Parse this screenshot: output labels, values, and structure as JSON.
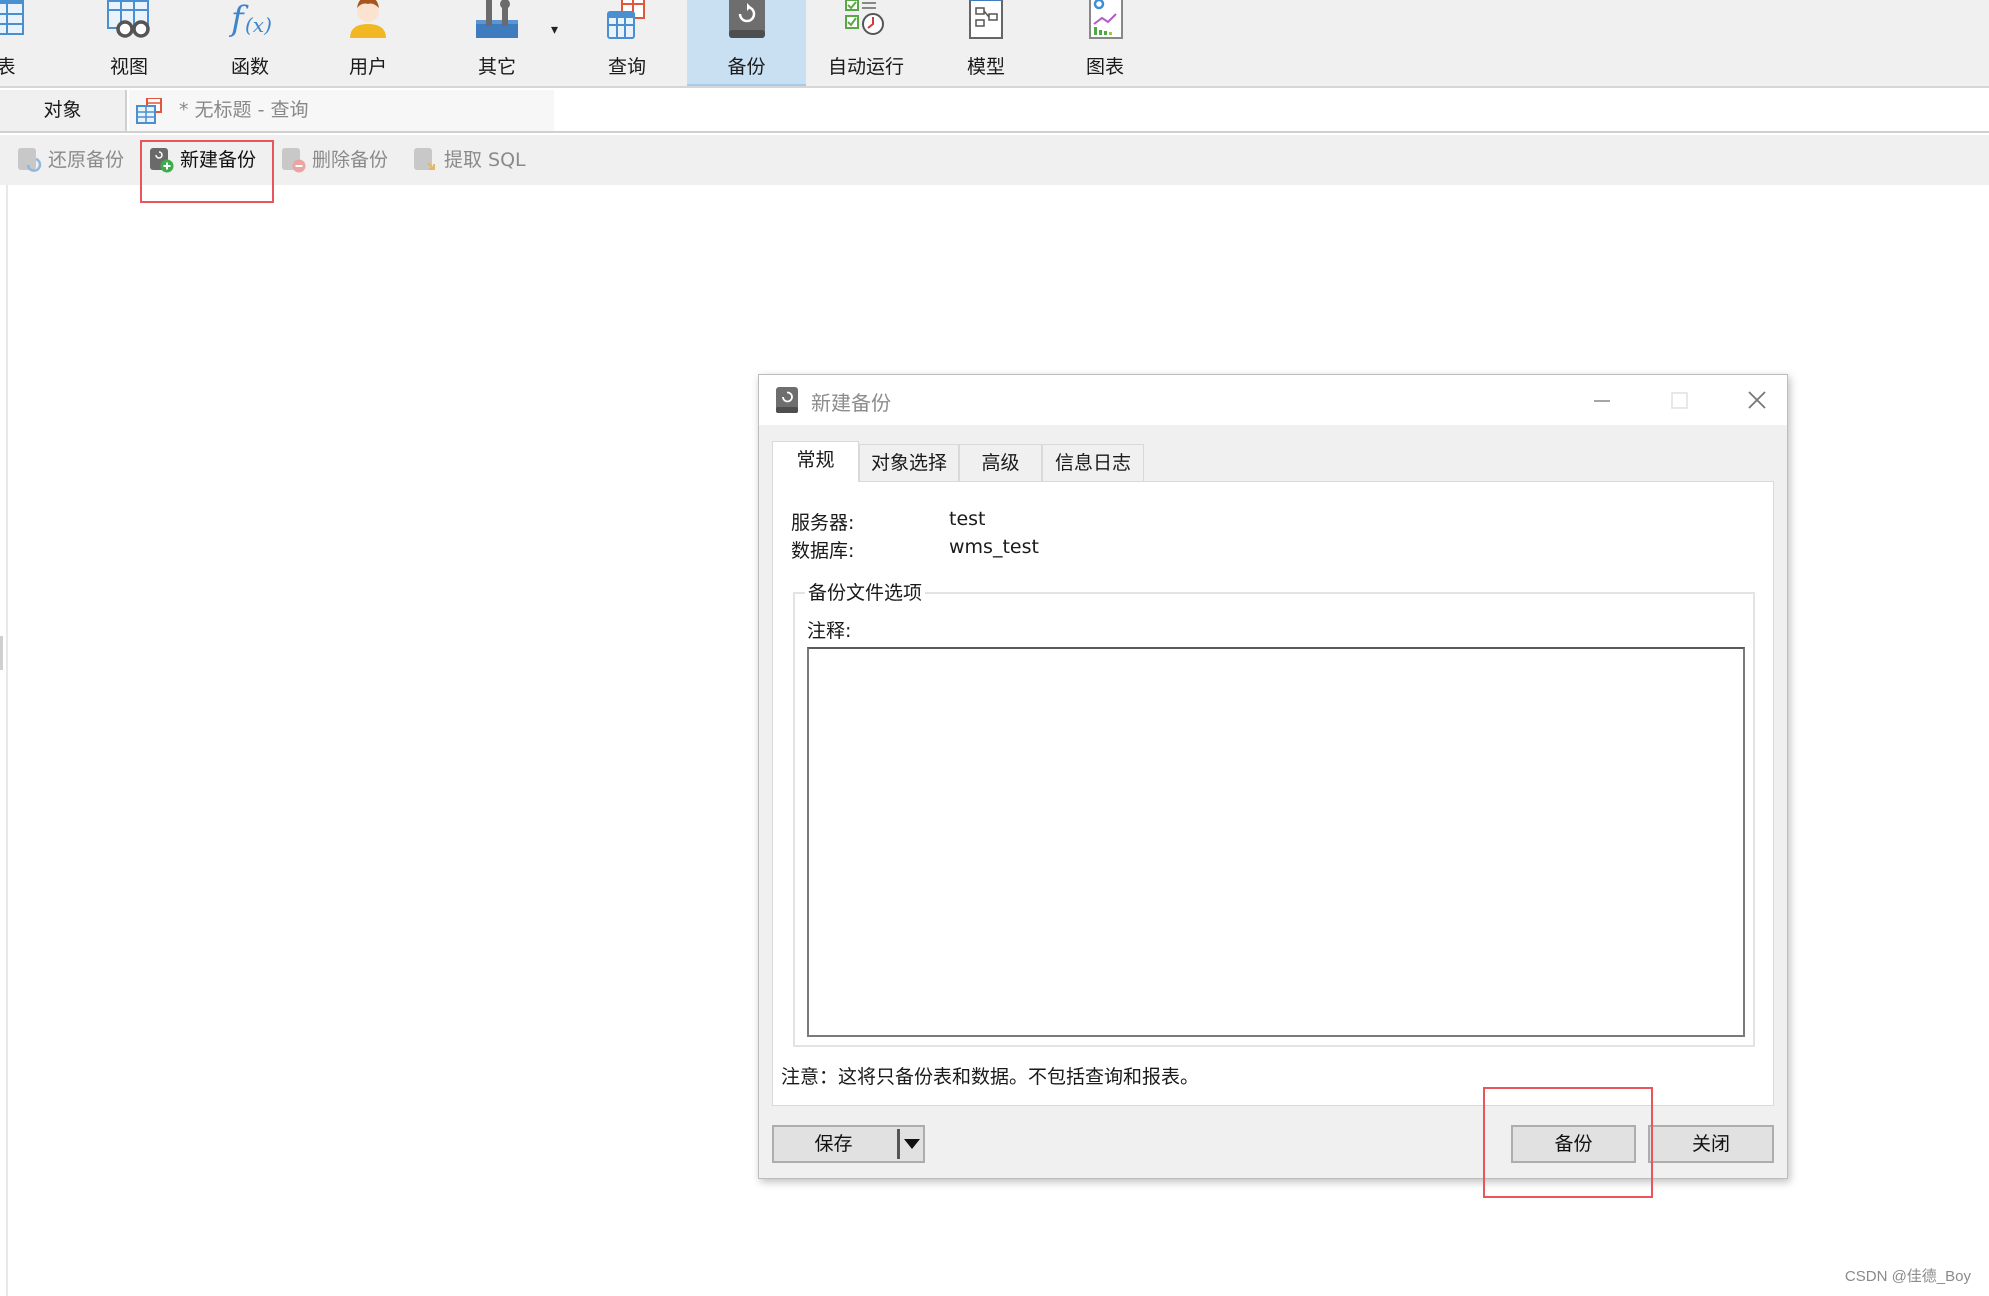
{
  "toolbar": {
    "items": [
      {
        "label": "表",
        "icon": "table-icon"
      },
      {
        "label": "视图",
        "icon": "view-icon"
      },
      {
        "label": "函数",
        "icon": "function-icon"
      },
      {
        "label": "用户",
        "icon": "user-icon"
      },
      {
        "label": "其它",
        "icon": "tools-icon"
      },
      {
        "label": "查询",
        "icon": "query-icon"
      },
      {
        "label": "备份",
        "icon": "backup-icon",
        "active": true
      },
      {
        "label": "自动运行",
        "icon": "schedule-icon"
      },
      {
        "label": "模型",
        "icon": "model-icon"
      },
      {
        "label": "图表",
        "icon": "chart-icon"
      }
    ],
    "dropdown_arrow": "▾"
  },
  "tabs": {
    "objects": "对象",
    "query": "* 无标题 - 查询"
  },
  "subtoolbar": {
    "items": [
      {
        "label": "还原备份",
        "enabled": false
      },
      {
        "label": "新建备份",
        "enabled": true
      },
      {
        "label": "删除备份",
        "enabled": false
      },
      {
        "label": "提取 SQL",
        "enabled": false
      }
    ]
  },
  "dialog": {
    "title": "新建备份",
    "tabs": [
      "常规",
      "对象选择",
      "高级",
      "信息日志"
    ],
    "active_tab": "常规",
    "server_label": "服务器:",
    "server_value": "test",
    "database_label": "数据库:",
    "database_value": "wms_test",
    "group_title": "备份文件选项",
    "comment_label": "注释:",
    "comment_value": "",
    "note": "注意：这将只备份表和数据。不包括查询和报表。",
    "buttons": {
      "save": "保存",
      "backup": "备份",
      "close": "关闭"
    }
  },
  "colors": {
    "highlight_box": "#e8555a",
    "active_tool": "#c9dff2"
  },
  "watermark": "CSDN @佳德_Boy"
}
